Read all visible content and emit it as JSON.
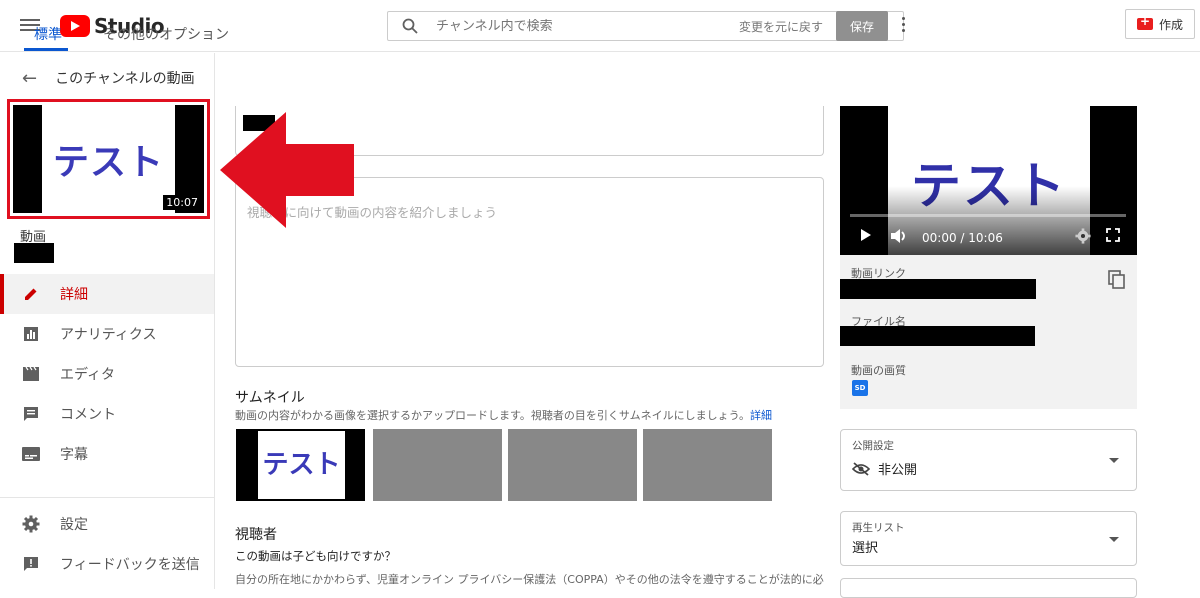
{
  "header": {
    "logo_text": "Studio",
    "search_placeholder": "チャンネル内で検索",
    "create_label": "作成"
  },
  "sidebar": {
    "back_title": "このチャンネルの動画",
    "thumbnail_text": "テスト",
    "thumbnail_duration": "10:07",
    "video_label": "動画",
    "items": [
      {
        "label": "詳細",
        "icon": "pencil-icon",
        "active": true
      },
      {
        "label": "アナリティクス",
        "icon": "analytics-icon",
        "active": false
      },
      {
        "label": "エディタ",
        "icon": "film-icon",
        "active": false
      },
      {
        "label": "コメント",
        "icon": "comment-icon",
        "active": false
      },
      {
        "label": "字幕",
        "icon": "subtitles-icon",
        "active": false
      }
    ],
    "bottom_items": [
      {
        "label": "設定",
        "icon": "gear-icon"
      },
      {
        "label": "フィードバックを送信",
        "icon": "feedback-icon"
      }
    ]
  },
  "tabs": {
    "standard": "標準",
    "other": "その他のオプション"
  },
  "toolbar": {
    "undo_label": "変更を元に戻す",
    "save_label": "保存"
  },
  "details": {
    "description_placeholder": "視聴者に向けて動画の内容を紹介しましょう",
    "thumbnail_heading": "サムネイル",
    "thumbnail_desc": "動画の内容がわかる画像を選択するかアップロードします。視聴者の目を引くサムネイルにしましょう。",
    "thumbnail_link": "詳細",
    "thumbnail_tile_text": "テスト",
    "audience_heading": "視聴者",
    "audience_question": "この動画は子ども向けですか？",
    "audience_desc": "自分の所在地にかかわらず、児童オンライン プライバシー保護法（COPPA）やその他の法令を遵守することが法的に必"
  },
  "preview": {
    "video_text": "テスト",
    "time": "00:00 / 10:06",
    "link_label": "動画リンク",
    "file_label": "ファイル名",
    "quality_label": "動画の画質",
    "quality_badge": "SD"
  },
  "visibility": {
    "label": "公開設定",
    "value": "非公開"
  },
  "playlist": {
    "label": "再生リスト",
    "value": "選択"
  },
  "colors": {
    "accent_blue": "#0b57d0",
    "active_red": "#cc0000",
    "annotation_red": "#e01020"
  }
}
